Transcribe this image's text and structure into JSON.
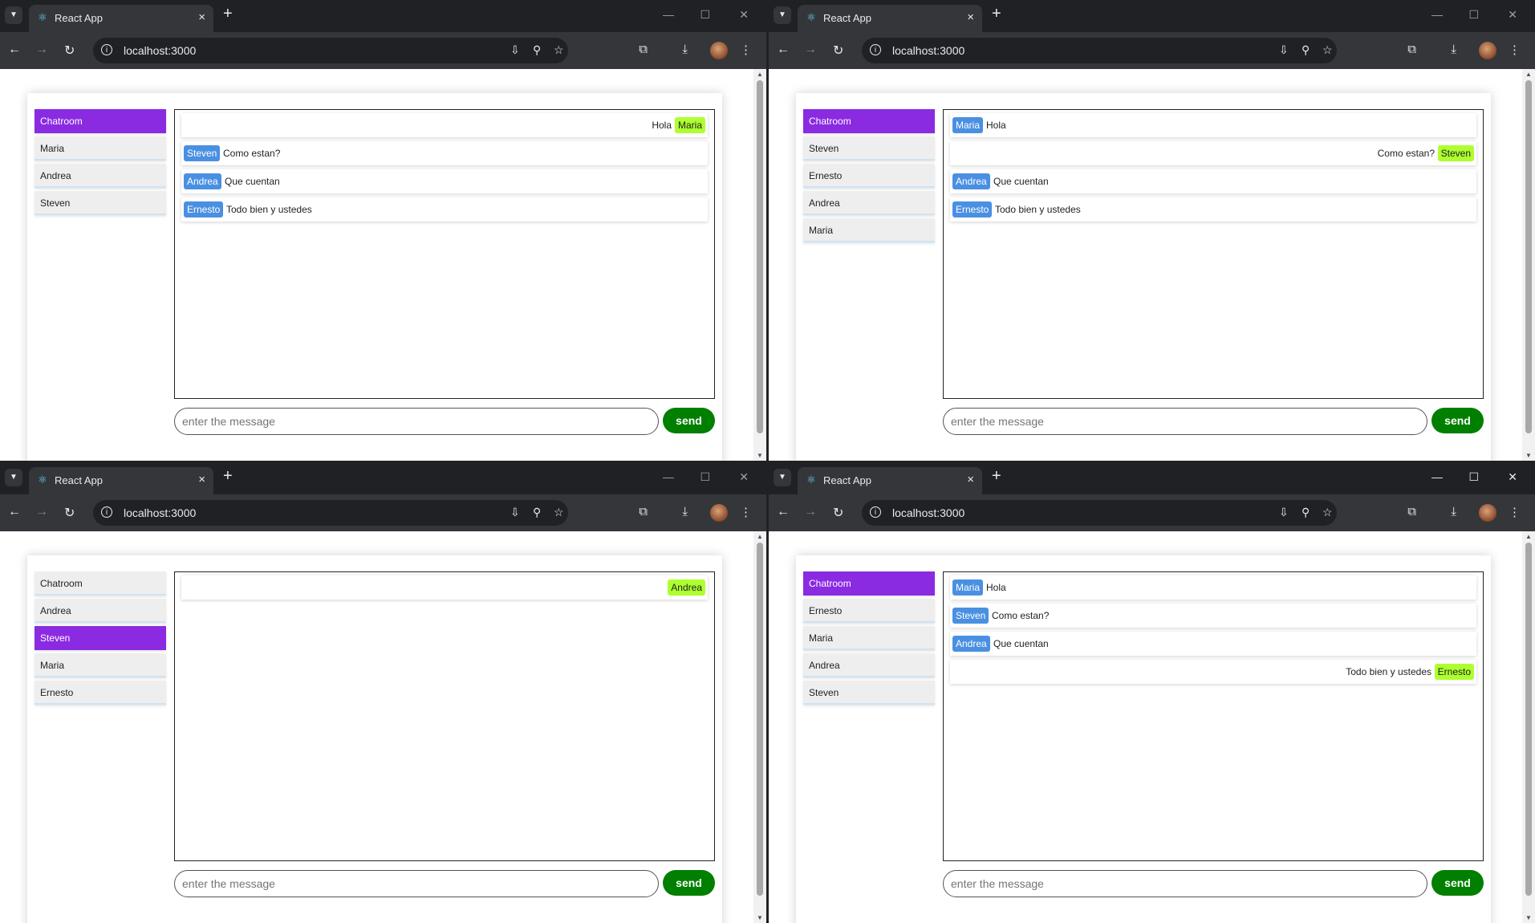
{
  "browser": {
    "tab_title": "React App",
    "url": "localhost:3000",
    "close_tab_glyph": "×",
    "new_tab_glyph": "+",
    "minimize_glyph": "—",
    "maximize_glyph": "☐",
    "close_window_glyph": "✕"
  },
  "composer": {
    "placeholder": "enter the message",
    "send_label": "send"
  },
  "colors": {
    "active_room": "#8a2be2",
    "incoming_badge": "#4a90e2",
    "own_badge": "#adff2f",
    "send_button": "#007f00"
  },
  "windows": [
    {
      "sidebar": [
        "Chatroom",
        "Maria",
        "Andrea",
        "Steven"
      ],
      "active_index": 0,
      "messages": [
        {
          "sender": "Maria",
          "text": "Hola",
          "own": true
        },
        {
          "sender": "Steven",
          "text": "Como estan?",
          "own": false
        },
        {
          "sender": "Andrea",
          "text": "Que cuentan",
          "own": false
        },
        {
          "sender": "Ernesto",
          "text": "Todo bien y ustedes",
          "own": false
        }
      ]
    },
    {
      "sidebar": [
        "Chatroom",
        "Steven",
        "Ernesto",
        "Andrea",
        "Maria"
      ],
      "active_index": 0,
      "messages": [
        {
          "sender": "Maria",
          "text": "Hola",
          "own": false
        },
        {
          "sender": "Steven",
          "text": "Como estan?",
          "own": true
        },
        {
          "sender": "Andrea",
          "text": "Que cuentan",
          "own": false
        },
        {
          "sender": "Ernesto",
          "text": "Todo bien y ustedes",
          "own": false
        }
      ]
    },
    {
      "sidebar": [
        "Chatroom",
        "Andrea",
        "Steven",
        "Maria",
        "Ernesto"
      ],
      "active_index": 2,
      "messages": [
        {
          "sender": "Andrea",
          "text": "",
          "own": true
        }
      ]
    },
    {
      "sidebar": [
        "Chatroom",
        "Ernesto",
        "Maria",
        "Andrea",
        "Steven"
      ],
      "active_index": 0,
      "messages": [
        {
          "sender": "Maria",
          "text": "Hola",
          "own": false
        },
        {
          "sender": "Steven",
          "text": "Como estan?",
          "own": false
        },
        {
          "sender": "Andrea",
          "text": "Que cuentan",
          "own": false
        },
        {
          "sender": "Ernesto",
          "text": "Todo bien y ustedes",
          "own": true
        }
      ]
    }
  ]
}
